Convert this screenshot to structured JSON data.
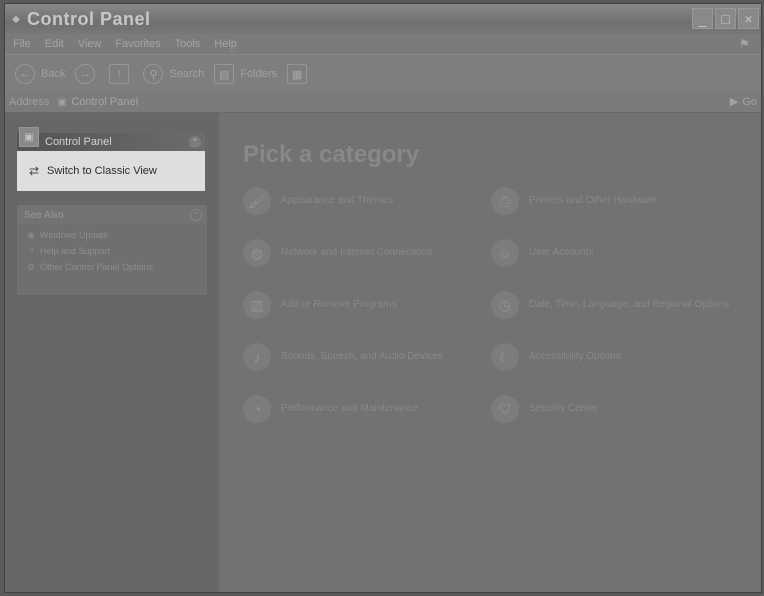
{
  "window": {
    "title": "Control Panel",
    "buttons": [
      "_",
      "□",
      "×"
    ]
  },
  "menu": [
    "File",
    "Edit",
    "View",
    "Favorites",
    "Tools",
    "Help"
  ],
  "toolbar": {
    "back": "Back",
    "search": "Search",
    "folders": "Folders"
  },
  "address": {
    "label": "Address",
    "value": "Control Panel",
    "go": "Go"
  },
  "taskpane": {
    "panel_title": "Control Panel",
    "switch_label": "Switch to Classic View",
    "see_also_title": "See Also",
    "see_also": [
      "Windows Update",
      "Help and Support",
      "Other Control Panel Options"
    ]
  },
  "main": {
    "heading": "Pick a category",
    "categories": [
      "Appearance and Themes",
      "Network and Internet Connections",
      "Add or Remove Programs",
      "Sounds, Speech, and Audio Devices",
      "Performance and Maintenance",
      "Printers and Other Hardware",
      "User Accounts",
      "Date, Time, Language, and Regional Options",
      "Accessibility Options",
      "Security Center"
    ]
  }
}
